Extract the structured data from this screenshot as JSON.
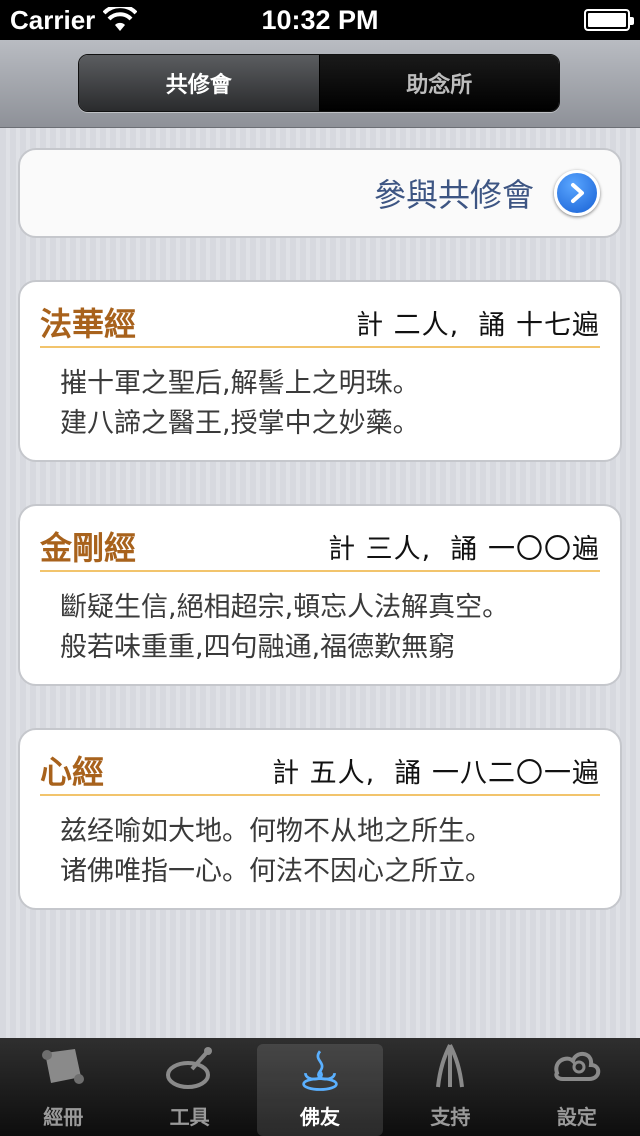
{
  "status": {
    "carrier": "Carrier",
    "time": "10:32 PM"
  },
  "segments": {
    "active": "共修會",
    "inactive": "助念所"
  },
  "join": {
    "label": "參與共修會"
  },
  "sutras": [
    {
      "title": "法華經",
      "stats": "計 二人,  誦 十七遍",
      "line1": "摧十軍之聖后,解髻上之明珠。",
      "line2": "建八諦之醫王,授掌中之妙藥。"
    },
    {
      "title": "金剛經",
      "stats": "計 三人,  誦 一〇〇遍",
      "line1": "斷疑生信,絕相超宗,頓忘人法解真空。",
      "line2": "般若味重重,四句融通,福德歎無窮"
    },
    {
      "title": "心經",
      "stats": "計 五人,  誦 一八二〇一遍",
      "line1": "兹经喻如大地。何物不从地之所生。",
      "line2": "诸佛唯指一心。何法不因心之所立。"
    }
  ],
  "tabs": [
    {
      "label": "經冊",
      "icon": "scroll-icon"
    },
    {
      "label": "工具",
      "icon": "bell-tool-icon"
    },
    {
      "label": "佛友",
      "icon": "lotus-icon"
    },
    {
      "label": "支持",
      "icon": "praying-hands-icon"
    },
    {
      "label": "設定",
      "icon": "cloud-settings-icon"
    }
  ],
  "colors": {
    "accent": "#a8621c",
    "link": "#3d5583",
    "divider": "#f2c46c",
    "button": "#1760d4"
  }
}
